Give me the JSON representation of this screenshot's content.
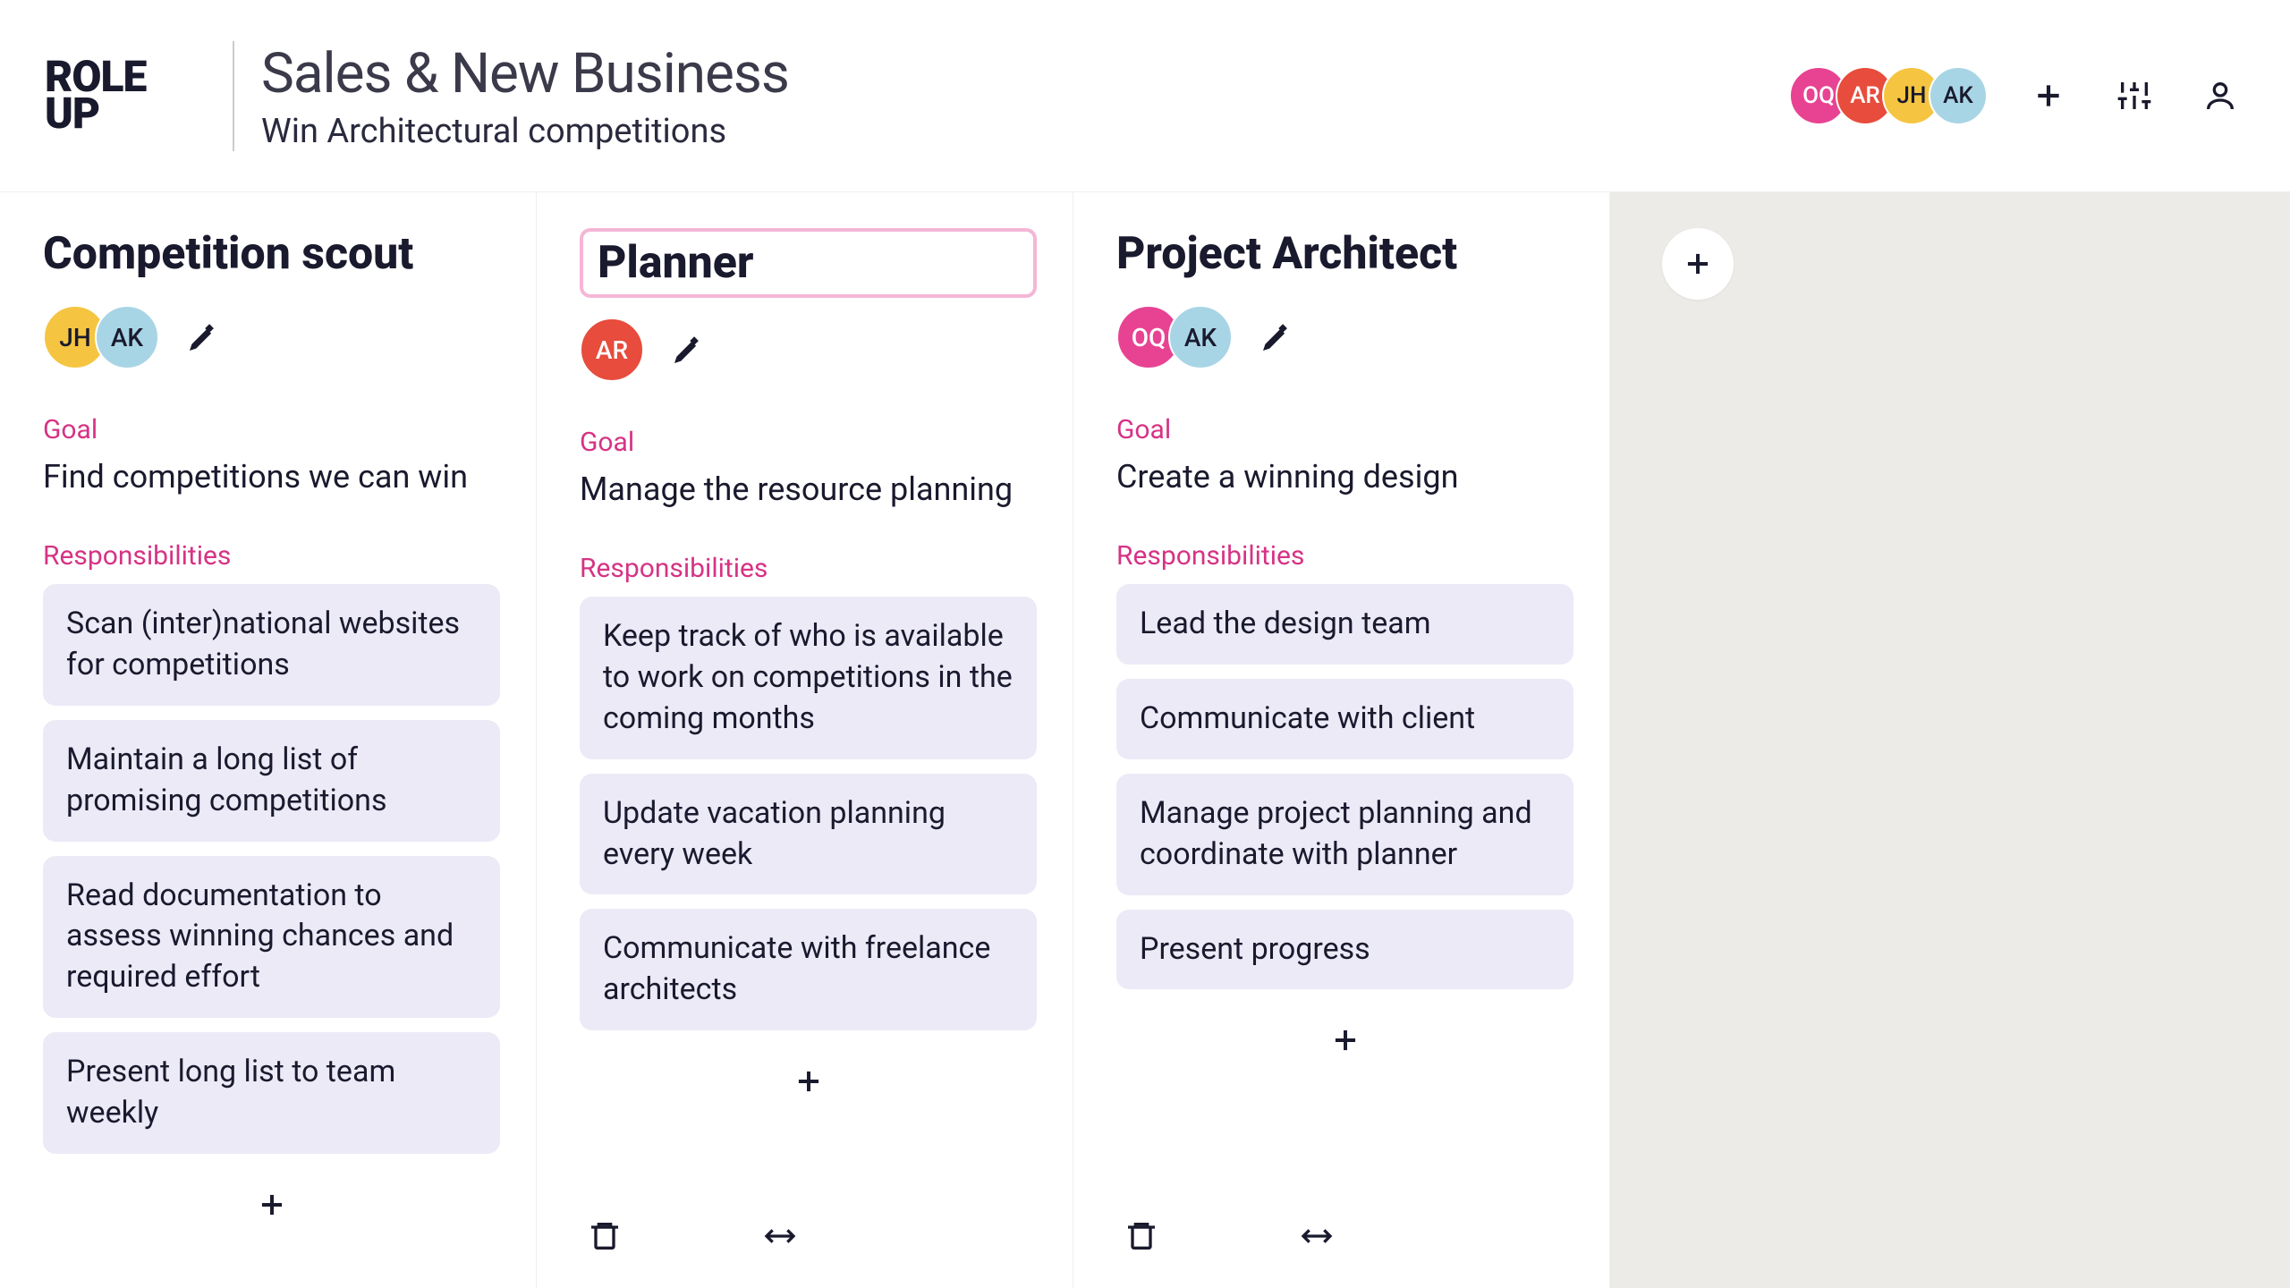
{
  "header": {
    "logo_line1": "ROLE",
    "logo_line2": "UP",
    "title": "Sales & New Business",
    "subtitle": "Win Architectural competitions",
    "team_avatars": [
      {
        "initials": "OQ",
        "color": "pink"
      },
      {
        "initials": "AR",
        "color": "red"
      },
      {
        "initials": "JH",
        "color": "yellow"
      },
      {
        "initials": "AK",
        "color": "blue"
      }
    ]
  },
  "labels": {
    "goal": "Goal",
    "responsibilities": "Responsibilities"
  },
  "columns": [
    {
      "title": "Competition scout",
      "editing": false,
      "avatars": [
        {
          "initials": "JH",
          "color": "yellow"
        },
        {
          "initials": "AK",
          "color": "blue"
        }
      ],
      "goal": "Find competitions we can win",
      "responsibilities": [
        "Scan (inter)national websites for competitions",
        "Maintain a long list of promising competitions",
        "Read documentation to assess winning chances and required effort",
        "Present long list to team weekly"
      ],
      "show_footer": false
    },
    {
      "title": "Planner",
      "editing": true,
      "avatars": [
        {
          "initials": "AR",
          "color": "red"
        }
      ],
      "goal": "Manage the resource planning",
      "responsibilities": [
        "Keep track of who is available to work on competitions in the coming months",
        "Update vacation planning every week",
        "Communicate with freelance architects"
      ],
      "show_footer": true
    },
    {
      "title": "Project Architect",
      "editing": false,
      "avatars": [
        {
          "initials": "OQ",
          "color": "pink"
        },
        {
          "initials": "AK",
          "color": "blue"
        }
      ],
      "goal": "Create a winning design",
      "responsibilities": [
        "Lead the design team",
        "Communicate with client",
        "Manage project planning and coordinate with planner",
        "Present progress"
      ],
      "show_footer": true
    }
  ]
}
